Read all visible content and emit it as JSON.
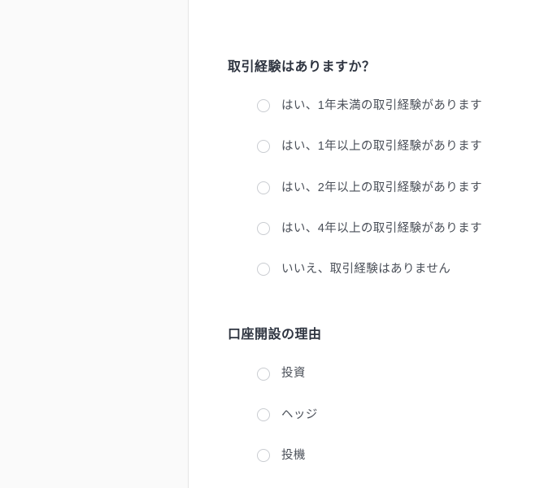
{
  "questions": [
    {
      "heading": "取引経験はありますか？",
      "options": [
        "はい、1年未満の取引経験があります",
        "はい、1年以上の取引経験があります",
        "はい、2年以上の取引経験があります",
        "はい、4年以上の取引経験があります",
        "いいえ、取引経験はありません"
      ]
    },
    {
      "heading": "口座開設の理由",
      "options": [
        "投資",
        "ヘッジ",
        "投機"
      ]
    }
  ]
}
